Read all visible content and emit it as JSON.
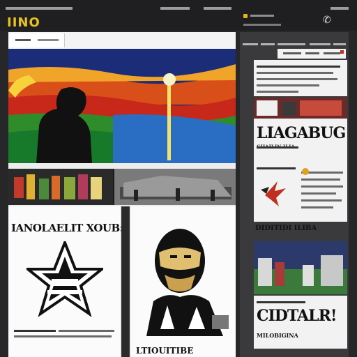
{
  "header": {
    "logo": "IINO",
    "phone_icon": "phone-icon"
  },
  "main": {
    "card_left_title": "IANOLAELIT XOUB:",
    "card_right_footer": "LTIOUITIBE"
  },
  "sidebar": {
    "headline_1": "LIAGABUG",
    "subhead_1": "CHAILIN ILIA",
    "headline_2": "CIDTALR!",
    "subhead_2": "MILOBIGINA",
    "small_label_1": "DIDITIDI ILIBA"
  },
  "colors": {
    "accent": "#e8c21e",
    "background": "#27272a",
    "panel": "#f2f2f2"
  }
}
